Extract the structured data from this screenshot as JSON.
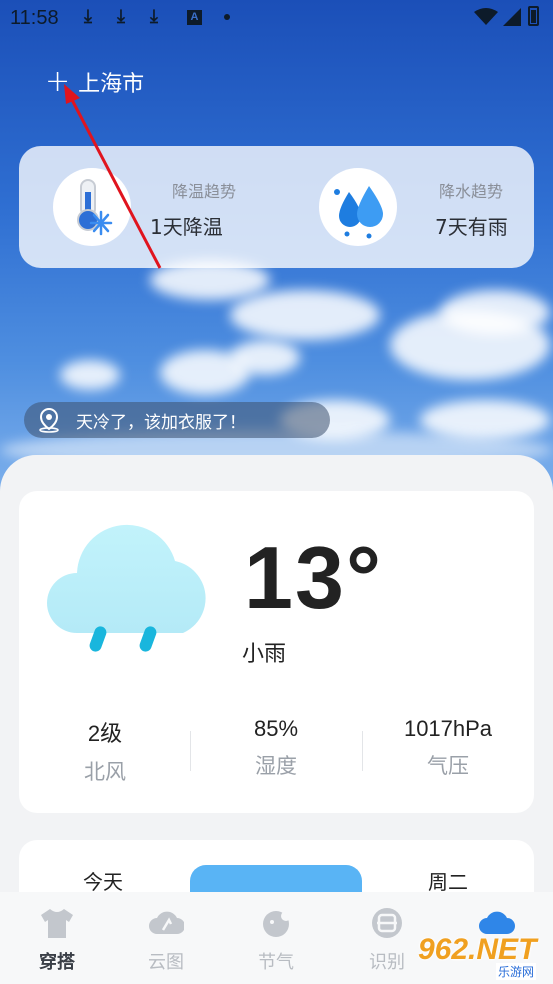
{
  "status_bar": {
    "time": "11:58",
    "indicator": "A"
  },
  "header": {
    "add_symbol": "+",
    "city": "上海市"
  },
  "trends": [
    {
      "title": "降温趋势",
      "value": "1天降温",
      "icon": "thermometer-snow-icon"
    },
    {
      "title": "降水趋势",
      "value": "7天有雨",
      "icon": "water-drops-icon"
    }
  ],
  "tip": {
    "text": "天冷了，该加衣服了！",
    "icon": "location-pin-icon"
  },
  "current": {
    "temperature": "13°",
    "condition": "小雨",
    "icon": "rain-cloud-icon",
    "stats": [
      {
        "value": "2级",
        "label": "北风"
      },
      {
        "value": "85%",
        "label": "湿度"
      },
      {
        "value": "1017hPa",
        "label": "气压"
      }
    ]
  },
  "days": {
    "tabs": [
      "今天",
      "周二"
    ]
  },
  "nav": {
    "items": [
      {
        "label": "穿搭",
        "icon": "shirt-icon",
        "active": true
      },
      {
        "label": "云图",
        "icon": "cloud-map-icon",
        "active": false
      },
      {
        "label": "节气",
        "icon": "solar-term-icon",
        "active": false
      },
      {
        "label": "识别",
        "icon": "scan-icon",
        "active": false
      },
      {
        "label": "",
        "icon": "weather-cloud-icon",
        "active": false
      }
    ]
  },
  "watermark": {
    "brand": "962.NET",
    "sub": "乐游网"
  },
  "colors": {
    "accent": "#59b4f5",
    "annotation": "#e0141e"
  }
}
